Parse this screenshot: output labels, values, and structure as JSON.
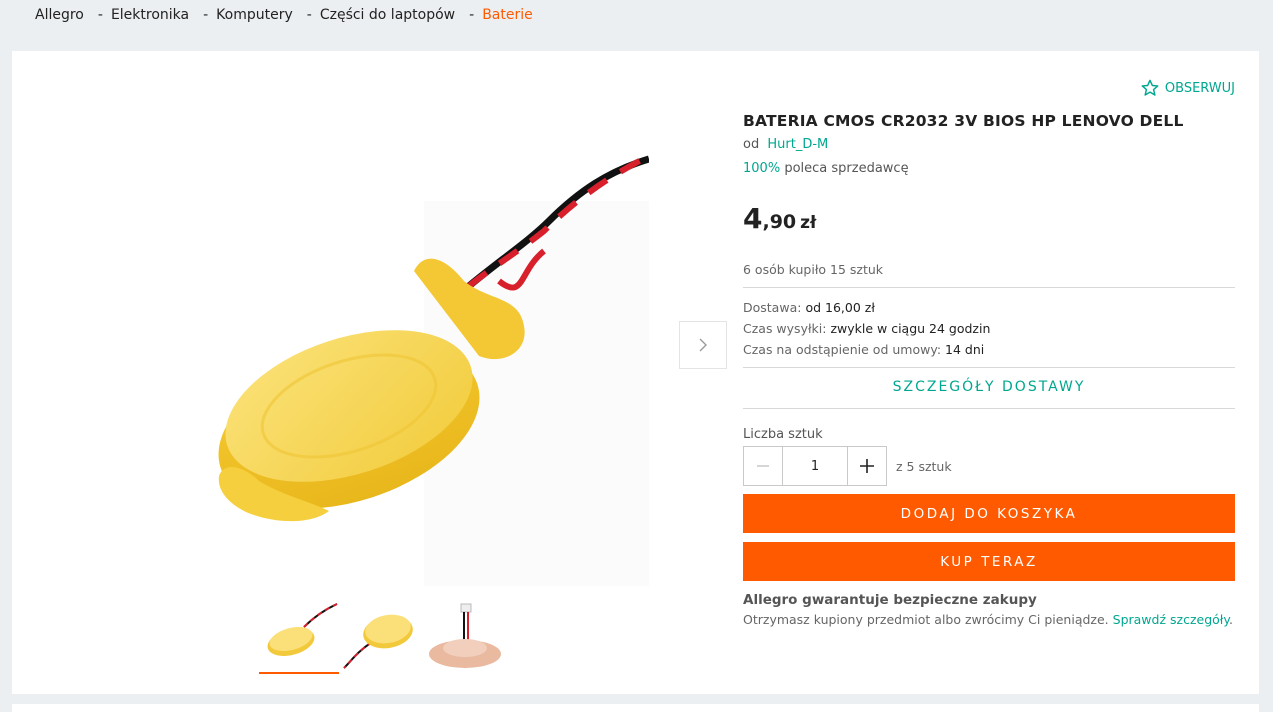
{
  "breadcrumb": [
    {
      "label": "Allegro"
    },
    {
      "label": "Elektronika"
    },
    {
      "label": "Komputery"
    },
    {
      "label": "Części do laptopów"
    },
    {
      "label": "Baterie"
    }
  ],
  "product": {
    "watch_label": "OBSERWUJ",
    "title": "BATERIA CMOS CR2032 3V BIOS HP LENOVO DELL",
    "seller_prefix": "od",
    "seller_name": "Hurt_D-M",
    "recommend_pct": "100%",
    "recommend_text": "poleca sprzedawcę",
    "price_int": "4",
    "price_dec": ",90",
    "currency": "zł",
    "bought_text": "6 osób kupiło 15 sztuk"
  },
  "delivery": {
    "cost_label": "Dostawa:",
    "cost_value": "od 16,00 zł",
    "dispatch_label": "Czas wysyłki:",
    "dispatch_value": "zwykle w ciągu 24 godzin",
    "withdraw_label": "Czas na odstąpienie od umowy:",
    "withdraw_value": "14 dni",
    "details_link": "SZCZEGÓŁY DOSTAWY"
  },
  "quantity": {
    "label": "Liczba sztuk",
    "value": "1",
    "of_text": "z 5 sztuk"
  },
  "buttons": {
    "add_to_cart": "DODAJ DO KOSZYKA",
    "buy_now": "KUP TERAZ"
  },
  "guarantee": {
    "title": "Allegro gwarantuje bezpieczne zakupy",
    "text": "Otrzymasz kupiony przedmiot albo zwrócimy Ci pieniądze.",
    "link": "Sprawdź szczegóły",
    "suffix": "."
  },
  "colors": {
    "accent": "#ff5a00",
    "link": "#00a790",
    "battery": "#f7d44a"
  },
  "gallery": {
    "thumb_count": 3,
    "active_thumb": 1
  }
}
